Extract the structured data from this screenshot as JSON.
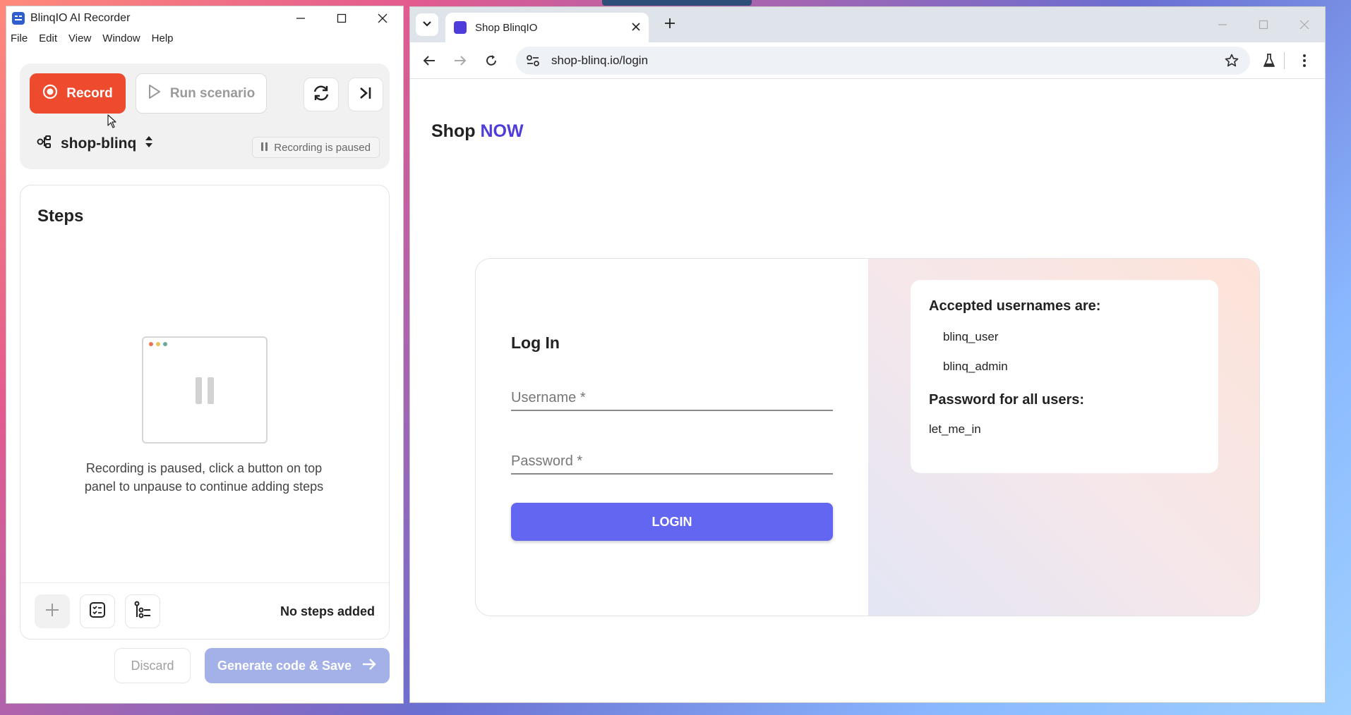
{
  "recorder": {
    "title": "BlinqIO AI Recorder",
    "menu": [
      "File",
      "Edit",
      "View",
      "Window",
      "Help"
    ],
    "record_label": "Record",
    "run_label": "Run scenario",
    "project_name": "shop-blinq",
    "status_badge": "Recording is paused",
    "steps_title": "Steps",
    "empty_message": "Recording is paused, click a button on top panel to unpause to continue adding steps",
    "no_steps": "No steps added",
    "discard_label": "Discard",
    "generate_label": "Generate code & Save",
    "colors": {
      "record": "#ee4a2d",
      "generate_disabled": "#a3b1e8"
    }
  },
  "browser": {
    "tab_title": "Shop BlinqIO",
    "url": "shop-blinq.io/login"
  },
  "page": {
    "brand_prefix": "Shop",
    "brand_accent": "NOW",
    "login_heading": "Log In",
    "username_placeholder": "Username *",
    "password_placeholder": "Password *",
    "login_button": "LOGIN",
    "info": {
      "usernames_heading": "Accepted usernames are:",
      "usernames": [
        "blinq_user",
        "blinq_admin"
      ],
      "password_heading": "Password for all users:",
      "password": "let_me_in"
    },
    "colors": {
      "accent": "#4e3ddb",
      "login_button": "#6366f1"
    }
  }
}
